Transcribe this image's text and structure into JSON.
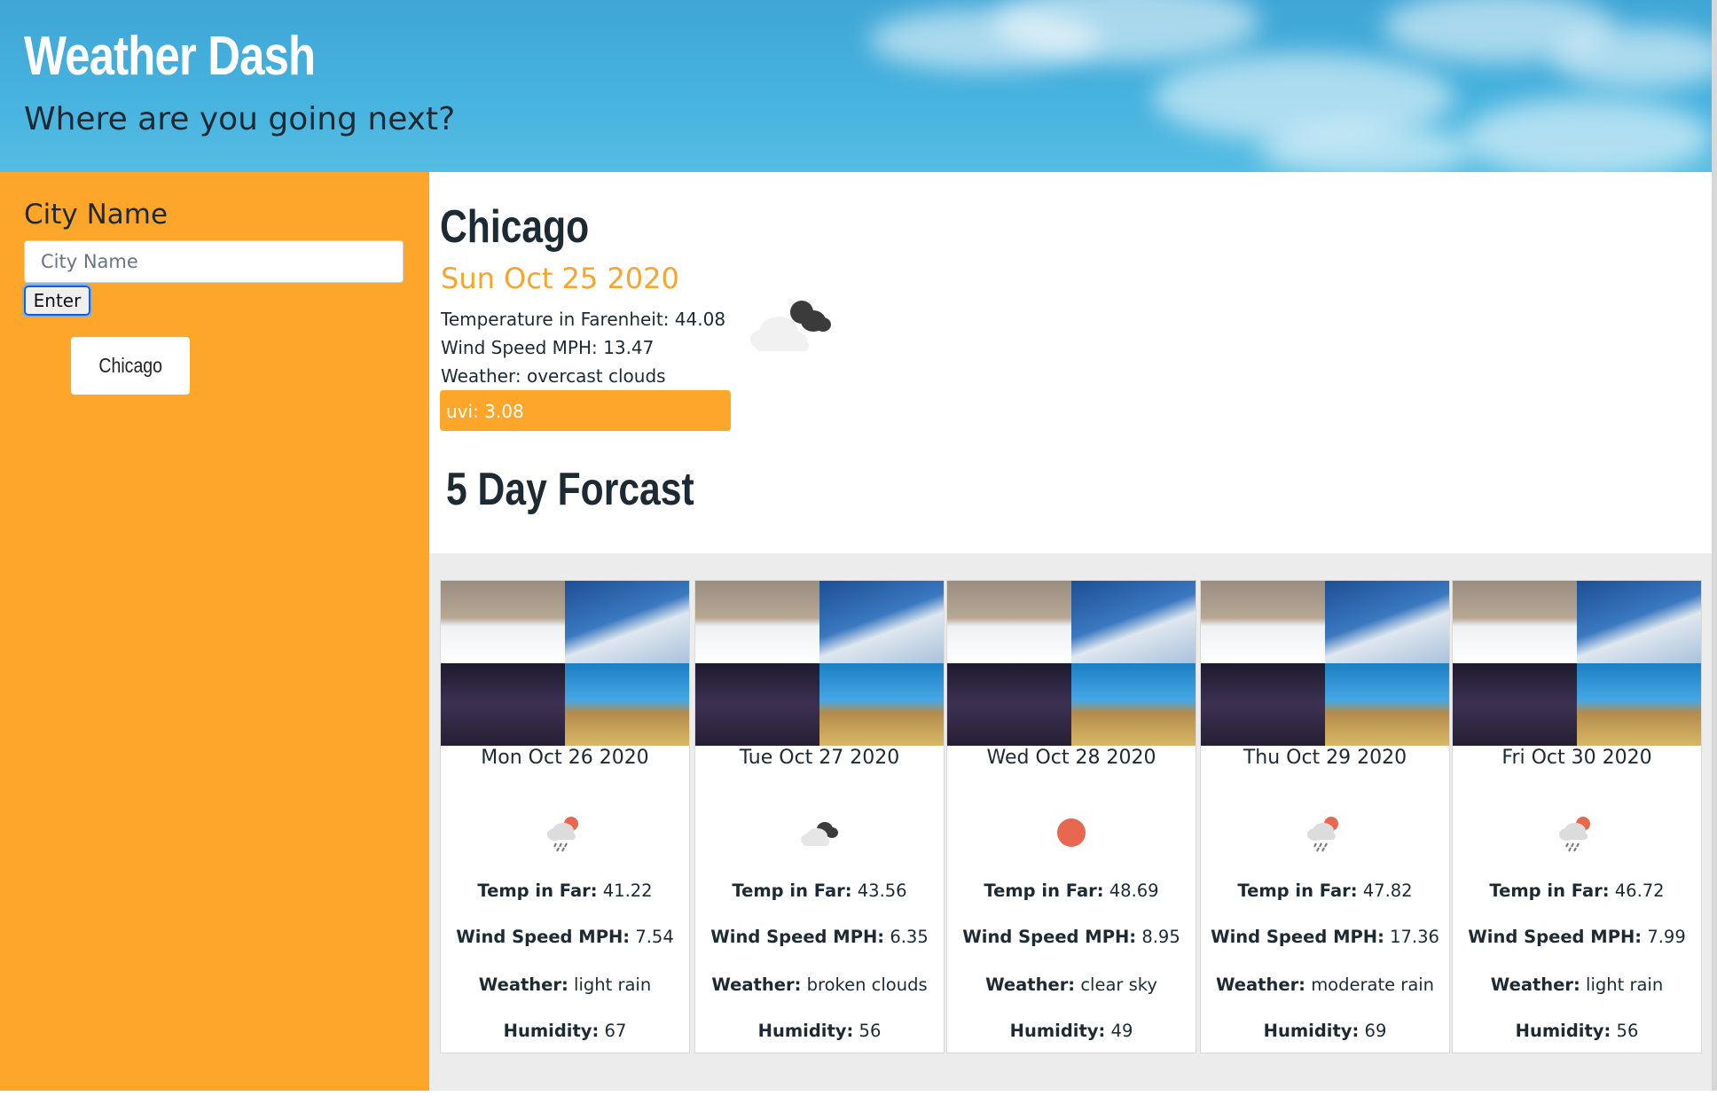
{
  "header": {
    "title": "Weather Dash",
    "subtitle": "Where are you going next?"
  },
  "sidebar": {
    "label": "City Name",
    "input": {
      "placeholder": "City Name",
      "value": ""
    },
    "enter_label": "Enter",
    "history": [
      "Chicago"
    ]
  },
  "current": {
    "city": "Chicago",
    "date": "Sun Oct 25 2020",
    "temperature": "Temperature in Farenheit: 44.08",
    "wind": "Wind Speed MPH: 13.47",
    "weather": "Weather: overcast clouds",
    "uvi": "uvi: 3.08",
    "icon": "overcast-clouds-icon"
  },
  "forecast": {
    "heading": "5 Day Forcast",
    "labels": {
      "temp": "Temp in Far:",
      "wind": "Wind Speed MPH:",
      "weather": "Weather:",
      "humidity": "Humidity:"
    },
    "days": [
      {
        "date": "Mon Oct 26 2020",
        "temp": "41.22",
        "wind": "7.54",
        "weather": "light rain",
        "humidity": "67",
        "icon": "rain-icon"
      },
      {
        "date": "Tue Oct 27 2020",
        "temp": "43.56",
        "wind": "6.35",
        "weather": "broken clouds",
        "humidity": "56",
        "icon": "broken-clouds-icon"
      },
      {
        "date": "Wed Oct 28 2020",
        "temp": "48.69",
        "wind": "8.95",
        "weather": "clear sky",
        "humidity": "49",
        "icon": "clear-sky-icon"
      },
      {
        "date": "Thu Oct 29 2020",
        "temp": "47.82",
        "wind": "17.36",
        "weather": "moderate rain",
        "humidity": "69",
        "icon": "rain-icon"
      },
      {
        "date": "Fri Oct 30 2020",
        "temp": "46.72",
        "wind": "7.99",
        "weather": "light rain",
        "humidity": "56",
        "icon": "rain-icon"
      }
    ]
  },
  "colors": {
    "accent_orange": "#fea629",
    "date_orange": "#f7a52c",
    "header_sky": "#47b3df",
    "sun": "#e8674f"
  }
}
